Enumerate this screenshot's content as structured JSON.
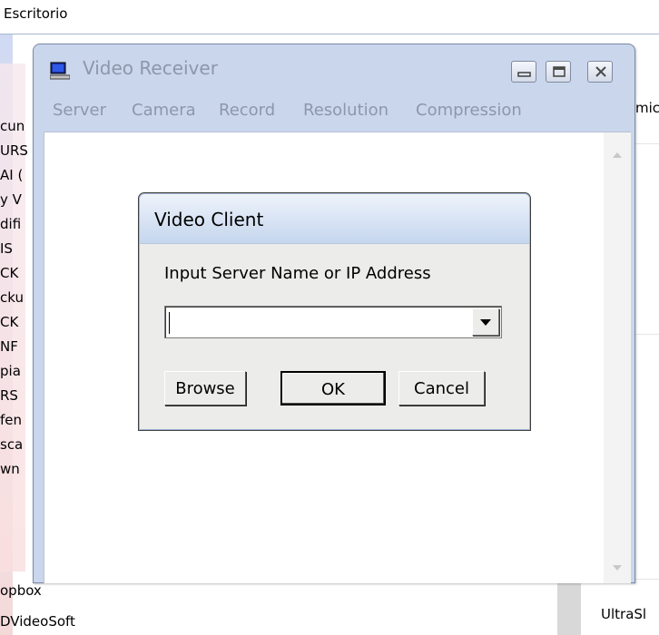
{
  "background": {
    "window_title": "Escritorio",
    "left_fragments": [
      "cun",
      "URS",
      "AI (",
      "y V",
      "difi",
      "IS",
      "CK",
      "cku",
      "CK",
      "NF",
      "pia",
      "RS",
      "fen",
      "sca",
      "wn"
    ],
    "bottom_items": [
      "opbox",
      "DVideoSoft"
    ],
    "right_fragments": [
      "mic",
      "UltraSl"
    ]
  },
  "receiver": {
    "title": "Video Receiver",
    "menu": [
      "Server",
      "Camera",
      "Record",
      "Resolution",
      "Compression"
    ],
    "icons": {
      "app": "monitor-icon",
      "minimize": "minimize-icon",
      "maximize": "maximize-icon",
      "close": "close-icon"
    }
  },
  "client_dialog": {
    "title": "Video Client",
    "prompt": "Input Server Name or IP Address",
    "server_value": "",
    "buttons": {
      "browse": "Browse",
      "ok": "OK",
      "cancel": "Cancel"
    },
    "icons": {
      "dropdown": "chevron-down-icon"
    }
  },
  "colors": {
    "inactive_text": "#8d97aa",
    "frame": "#cad6ec",
    "dialog_face": "#ececea"
  }
}
